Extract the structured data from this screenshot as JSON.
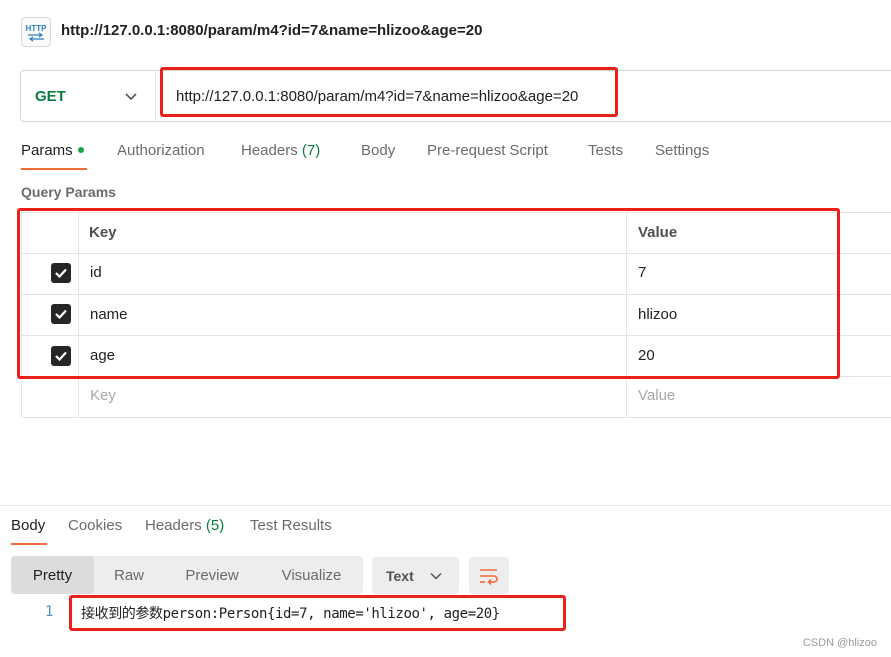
{
  "header": {
    "icon": "http-file-icon",
    "icon_label": "HTTP",
    "title": "http://127.0.0.1:8080/param/m4?id=7&name=hlizoo&age=20"
  },
  "request": {
    "method": "GET",
    "url": "http://127.0.0.1:8080/param/m4?id=7&name=hlizoo&age=20"
  },
  "request_tabs": [
    {
      "label": "Params",
      "active": true,
      "dot": true
    },
    {
      "label": "Authorization"
    },
    {
      "label": "Headers",
      "count": "(7)"
    },
    {
      "label": "Body"
    },
    {
      "label": "Pre-request Script"
    },
    {
      "label": "Tests"
    },
    {
      "label": "Settings"
    }
  ],
  "query_params": {
    "section_label": "Query Params",
    "columns": {
      "key": "Key",
      "value": "Value"
    },
    "rows": [
      {
        "checked": true,
        "key": "id",
        "value": "7"
      },
      {
        "checked": true,
        "key": "name",
        "value": "hlizoo"
      },
      {
        "checked": true,
        "key": "age",
        "value": "20"
      }
    ],
    "placeholder": {
      "key": "Key",
      "value": "Value"
    }
  },
  "response_tabs": [
    {
      "label": "Body",
      "active": true
    },
    {
      "label": "Cookies"
    },
    {
      "label": "Headers",
      "count": "(5)"
    },
    {
      "label": "Test Results"
    }
  ],
  "view_modes": [
    "Pretty",
    "Raw",
    "Preview",
    "Visualize"
  ],
  "active_view_mode": "Pretty",
  "format": "Text",
  "response_body": {
    "line_number": "1",
    "text": "接收到的参数person:Person{id=7, name='hlizoo', age=20}"
  },
  "watermark": "CSDN @hlizoo",
  "colors": {
    "accent": "#f26b3a",
    "method_get": "#0a7d3e",
    "highlight": "#e8211a",
    "params_dot": "#1ea34a"
  }
}
